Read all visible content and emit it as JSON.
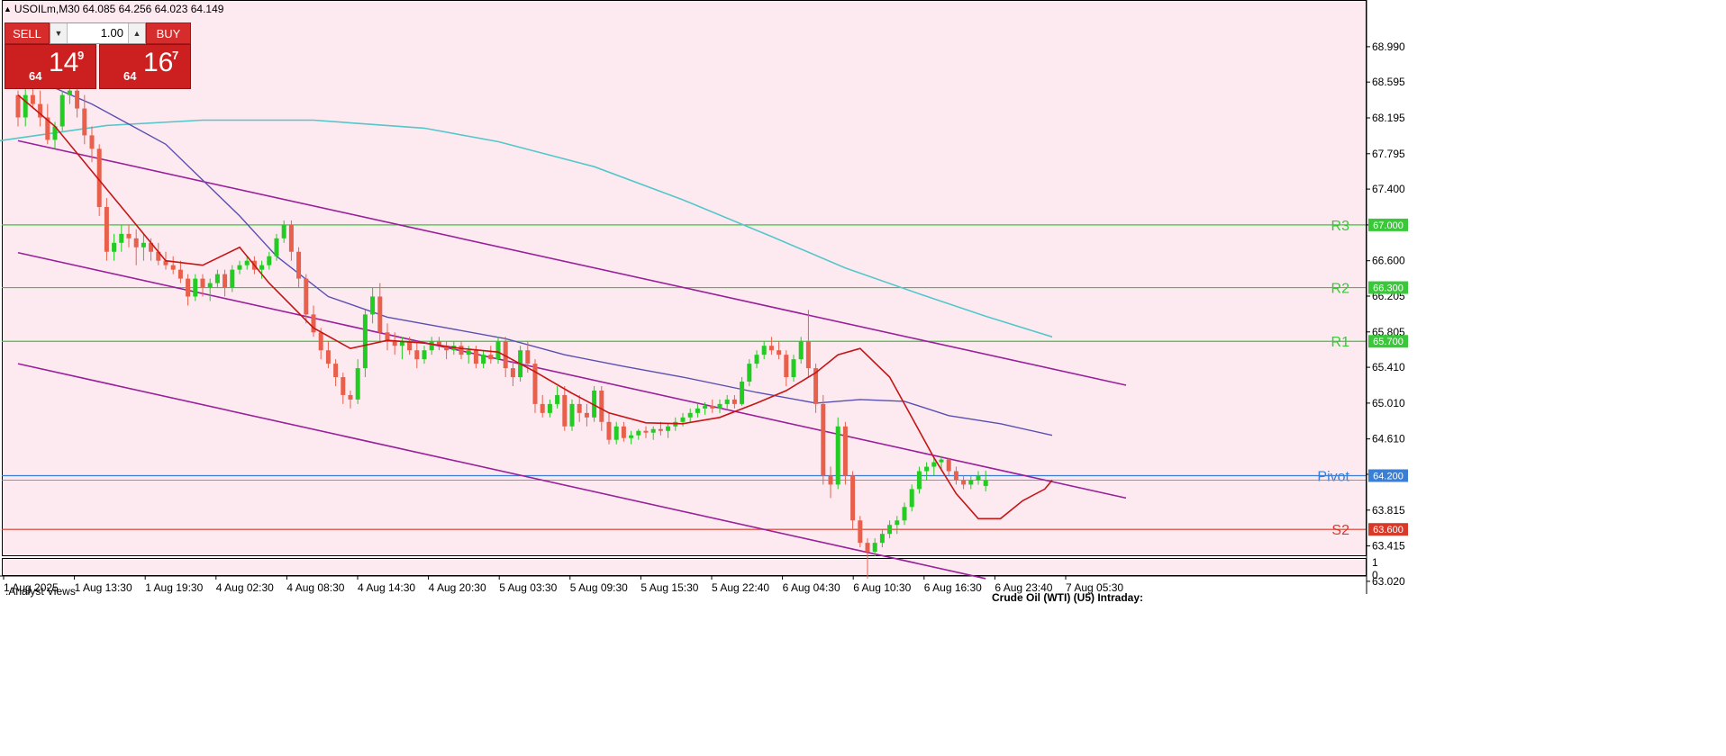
{
  "header": {
    "symbol_timeframe": "USOILm,M30",
    "ohlc": "64.085 64.256 64.023 64.149"
  },
  "trade_panel": {
    "sell_label": "SELL",
    "buy_label": "BUY",
    "lot_value": "1.00",
    "sell_price_small": "64",
    "sell_price_big": "14",
    "sell_price_sup": "9",
    "buy_price_small": "64",
    "buy_price_big": "16",
    "buy_price_sup": "7"
  },
  "indicator_window": {
    "label": ".Analyst Views",
    "scale_top": "1",
    "scale_bottom": "0"
  },
  "footer_title": "Crude Oil (WTI) (U5) Intraday:",
  "colors": {
    "background": "#fdeaf1",
    "bull_candle": "#22cc22",
    "bear_candle": "#e8604c",
    "ma_fast": "#c51515",
    "ma_mid": "#5a4fb0",
    "ma_slow": "#55c6c9",
    "channel": "#9a1f9a",
    "resistance": "#38c838",
    "pivot": "#3a7fd4",
    "support": "#d83a2a"
  },
  "chart_data": {
    "type": "candlestick",
    "price_axis_ticks": [
      "68.990",
      "68.595",
      "68.195",
      "67.795",
      "67.400",
      "67.000",
      "66.600",
      "66.205",
      "65.805",
      "65.410",
      "65.010",
      "64.610",
      "64.215",
      "63.815",
      "63.415",
      "63.020"
    ],
    "time_axis_ticks": [
      "1 Aug 2025",
      "1 Aug 13:30",
      "1 Aug 19:30",
      "4 Aug 02:30",
      "4 Aug 08:30",
      "4 Aug 14:30",
      "4 Aug 20:30",
      "5 Aug 03:30",
      "5 Aug 09:30",
      "5 Aug 15:30",
      "5 Aug 22:40",
      "6 Aug 04:30",
      "6 Aug 10:30",
      "6 Aug 16:30",
      "6 Aug 23:40",
      "7 Aug 05:30"
    ],
    "current_price": 64.149,
    "levels": [
      {
        "label": "R3",
        "value": 67.0,
        "tag": "67.000",
        "role": "resistance"
      },
      {
        "label": "R2",
        "value": 66.3,
        "tag": "66.300",
        "role": "resistance"
      },
      {
        "label": "R1",
        "value": 65.7,
        "tag": "65.700",
        "role": "resistance"
      },
      {
        "label": "Pivot",
        "value": 64.2,
        "tag": "64.200",
        "role": "pivot"
      },
      {
        "label": "S2",
        "value": 63.6,
        "tag": "63.600",
        "role": "support"
      }
    ],
    "channel": {
      "upper": [
        [
          0,
          67.94
        ],
        [
          150,
          65.21
        ]
      ],
      "middle": [
        [
          0,
          66.69
        ],
        [
          150,
          63.95
        ]
      ],
      "lower": [
        [
          0,
          65.45
        ],
        [
          131,
          63.05
        ]
      ]
    },
    "ma_slow": [
      [
        -10,
        67.85
      ],
      [
        0,
        67.97
      ],
      [
        12,
        68.11
      ],
      [
        25,
        68.17
      ],
      [
        40,
        68.17
      ],
      [
        55,
        68.08
      ],
      [
        65,
        67.93
      ],
      [
        78,
        67.65
      ],
      [
        90,
        67.28
      ],
      [
        102,
        66.87
      ],
      [
        112,
        66.52
      ],
      [
        122,
        66.23
      ],
      [
        131,
        65.98
      ],
      [
        140,
        65.75
      ]
    ],
    "ma_mid": [
      [
        3,
        68.6
      ],
      [
        10,
        68.35
      ],
      [
        20,
        67.9
      ],
      [
        30,
        67.1
      ],
      [
        35,
        66.65
      ],
      [
        42,
        66.2
      ],
      [
        50,
        65.97
      ],
      [
        58,
        65.85
      ],
      [
        66,
        65.73
      ],
      [
        74,
        65.55
      ],
      [
        82,
        65.42
      ],
      [
        90,
        65.3
      ],
      [
        100,
        65.13
      ],
      [
        108,
        65.01
      ],
      [
        114,
        65.05
      ],
      [
        120,
        65.03
      ],
      [
        126,
        64.87
      ],
      [
        133,
        64.78
      ],
      [
        140,
        64.65
      ]
    ],
    "ma_fast": [
      [
        0,
        68.45
      ],
      [
        5,
        68.1
      ],
      [
        10,
        67.6
      ],
      [
        15,
        67.1
      ],
      [
        20,
        66.6
      ],
      [
        25,
        66.55
      ],
      [
        30,
        66.75
      ],
      [
        34,
        66.35
      ],
      [
        40,
        65.85
      ],
      [
        45,
        65.62
      ],
      [
        50,
        65.71
      ],
      [
        55,
        65.68
      ],
      [
        60,
        65.62
      ],
      [
        65,
        65.58
      ],
      [
        70,
        65.36
      ],
      [
        75,
        65.12
      ],
      [
        80,
        64.9
      ],
      [
        85,
        64.79
      ],
      [
        90,
        64.78
      ],
      [
        95,
        64.85
      ],
      [
        100,
        65.01
      ],
      [
        104,
        65.15
      ],
      [
        108,
        65.35
      ],
      [
        111,
        65.55
      ],
      [
        114,
        65.62
      ],
      [
        118,
        65.3
      ],
      [
        121,
        64.85
      ],
      [
        124,
        64.4
      ],
      [
        127,
        64.0
      ],
      [
        130,
        63.72
      ],
      [
        133,
        63.72
      ],
      [
        136,
        63.92
      ],
      [
        139,
        64.05
      ],
      [
        140,
        64.15
      ]
    ],
    "candles": [
      [
        68.45,
        68.5,
        68.1,
        68.2
      ],
      [
        68.2,
        68.55,
        68.1,
        68.45
      ],
      [
        68.45,
        68.6,
        68.3,
        68.35
      ],
      [
        68.35,
        68.5,
        68.1,
        68.2
      ],
      [
        68.2,
        68.35,
        67.9,
        67.95
      ],
      [
        67.95,
        68.15,
        67.85,
        68.1
      ],
      [
        68.1,
        68.5,
        68.05,
        68.45
      ],
      [
        68.45,
        68.6,
        68.35,
        68.5
      ],
      [
        68.5,
        68.55,
        68.2,
        68.3
      ],
      [
        68.3,
        68.45,
        67.9,
        68.0
      ],
      [
        68.0,
        68.1,
        67.7,
        67.85
      ],
      [
        67.85,
        67.9,
        67.1,
        67.2
      ],
      [
        67.2,
        67.3,
        66.6,
        66.7
      ],
      [
        66.7,
        66.9,
        66.6,
        66.8
      ],
      [
        66.8,
        67.0,
        66.7,
        66.9
      ],
      [
        66.9,
        67.0,
        66.75,
        66.85
      ],
      [
        66.85,
        66.95,
        66.55,
        66.75
      ],
      [
        66.75,
        66.9,
        66.6,
        66.8
      ],
      [
        66.8,
        66.85,
        66.6,
        66.7
      ],
      [
        66.7,
        66.8,
        66.55,
        66.6
      ],
      [
        66.6,
        66.7,
        66.5,
        66.55
      ],
      [
        66.55,
        66.65,
        66.45,
        66.5
      ],
      [
        66.5,
        66.6,
        66.35,
        66.4
      ],
      [
        66.4,
        66.45,
        66.1,
        66.2
      ],
      [
        66.2,
        66.45,
        66.15,
        66.4
      ],
      [
        66.4,
        66.45,
        66.2,
        66.3
      ],
      [
        66.3,
        66.4,
        66.15,
        66.35
      ],
      [
        66.35,
        66.5,
        66.3,
        66.45
      ],
      [
        66.45,
        66.5,
        66.2,
        66.3
      ],
      [
        66.3,
        66.55,
        66.25,
        66.5
      ],
      [
        66.5,
        66.6,
        66.45,
        66.55
      ],
      [
        66.55,
        66.65,
        66.5,
        66.6
      ],
      [
        66.6,
        66.65,
        66.45,
        66.5
      ],
      [
        66.5,
        66.6,
        66.4,
        66.55
      ],
      [
        66.55,
        66.7,
        66.5,
        66.65
      ],
      [
        66.65,
        66.9,
        66.6,
        66.85
      ],
      [
        66.85,
        67.05,
        66.8,
        67.0
      ],
      [
        67.0,
        67.05,
        66.6,
        66.7
      ],
      [
        66.7,
        66.75,
        66.3,
        66.4
      ],
      [
        66.4,
        66.45,
        65.9,
        66.0
      ],
      [
        66.0,
        66.1,
        65.75,
        65.8
      ],
      [
        65.8,
        65.85,
        65.5,
        65.6
      ],
      [
        65.6,
        65.7,
        65.4,
        65.45
      ],
      [
        65.45,
        65.5,
        65.2,
        65.3
      ],
      [
        65.3,
        65.35,
        65.0,
        65.1
      ],
      [
        65.1,
        65.15,
        64.95,
        65.05
      ],
      [
        65.05,
        65.5,
        65.0,
        65.4
      ],
      [
        65.4,
        66.05,
        65.3,
        66.0
      ],
      [
        66.0,
        66.3,
        65.9,
        66.2
      ],
      [
        66.2,
        66.35,
        65.7,
        65.8
      ],
      [
        65.8,
        65.9,
        65.6,
        65.7
      ],
      [
        65.7,
        65.8,
        65.55,
        65.65
      ],
      [
        65.65,
        65.75,
        65.5,
        65.7
      ],
      [
        65.7,
        65.75,
        65.55,
        65.6
      ],
      [
        65.6,
        65.7,
        65.4,
        65.5
      ],
      [
        65.5,
        65.65,
        65.45,
        65.6
      ],
      [
        65.6,
        65.75,
        65.55,
        65.7
      ],
      [
        65.7,
        65.75,
        65.6,
        65.65
      ],
      [
        65.65,
        65.7,
        65.5,
        65.6
      ],
      [
        65.6,
        65.7,
        65.55,
        65.65
      ],
      [
        65.65,
        65.7,
        65.5,
        65.55
      ],
      [
        65.55,
        65.65,
        65.45,
        65.6
      ],
      [
        65.6,
        65.65,
        65.4,
        65.45
      ],
      [
        65.45,
        65.6,
        65.4,
        65.55
      ],
      [
        65.55,
        65.65,
        65.45,
        65.5
      ],
      [
        65.5,
        65.75,
        65.45,
        65.7
      ],
      [
        65.7,
        65.75,
        65.3,
        65.4
      ],
      [
        65.4,
        65.5,
        65.2,
        65.3
      ],
      [
        65.3,
        65.65,
        65.25,
        65.6
      ],
      [
        65.6,
        65.7,
        65.35,
        65.45
      ],
      [
        65.45,
        65.5,
        64.9,
        65.0
      ],
      [
        65.0,
        65.1,
        64.85,
        64.9
      ],
      [
        64.9,
        65.05,
        64.85,
        65.0
      ],
      [
        65.0,
        65.2,
        64.95,
        65.1
      ],
      [
        65.1,
        65.2,
        64.7,
        64.75
      ],
      [
        64.75,
        65.05,
        64.7,
        65.0
      ],
      [
        65.0,
        65.1,
        64.8,
        64.9
      ],
      [
        64.9,
        65.0,
        64.75,
        64.85
      ],
      [
        64.85,
        65.2,
        64.8,
        65.15
      ],
      [
        65.15,
        65.2,
        64.7,
        64.8
      ],
      [
        64.8,
        64.9,
        64.55,
        64.6
      ],
      [
        64.6,
        64.8,
        64.55,
        64.75
      ],
      [
        64.75,
        64.8,
        64.58,
        64.62
      ],
      [
        64.62,
        64.7,
        64.55,
        64.65
      ],
      [
        64.65,
        64.72,
        64.6,
        64.7
      ],
      [
        64.7,
        64.75,
        64.62,
        64.68
      ],
      [
        64.68,
        64.75,
        64.6,
        64.72
      ],
      [
        64.72,
        64.8,
        64.65,
        64.7
      ],
      [
        64.7,
        64.78,
        64.62,
        64.75
      ],
      [
        64.75,
        64.85,
        64.7,
        64.8
      ],
      [
        64.8,
        64.9,
        64.75,
        64.85
      ],
      [
        64.85,
        64.95,
        64.8,
        64.9
      ],
      [
        64.9,
        65.0,
        64.85,
        64.95
      ],
      [
        64.95,
        65.02,
        64.88,
        64.98
      ],
      [
        64.98,
        65.05,
        64.9,
        64.95
      ],
      [
        64.95,
        65.05,
        64.9,
        65.0
      ],
      [
        65.0,
        65.1,
        64.95,
        65.05
      ],
      [
        65.05,
        65.1,
        64.95,
        65.0
      ],
      [
        65.0,
        65.3,
        64.98,
        65.25
      ],
      [
        65.25,
        65.5,
        65.2,
        65.45
      ],
      [
        65.45,
        65.6,
        65.4,
        65.55
      ],
      [
        65.55,
        65.7,
        65.5,
        65.65
      ],
      [
        65.65,
        65.75,
        65.55,
        65.6
      ],
      [
        65.6,
        65.7,
        65.5,
        65.55
      ],
      [
        65.55,
        65.6,
        65.2,
        65.3
      ],
      [
        65.3,
        65.55,
        65.25,
        65.5
      ],
      [
        65.5,
        65.75,
        65.45,
        65.7
      ],
      [
        65.7,
        66.05,
        65.3,
        65.4
      ],
      [
        65.4,
        65.45,
        64.9,
        65.0
      ],
      [
        65.0,
        65.1,
        64.1,
        64.2
      ],
      [
        64.2,
        64.3,
        63.95,
        64.1
      ],
      [
        64.1,
        64.85,
        64.05,
        64.75
      ],
      [
        64.75,
        64.8,
        64.1,
        64.2
      ],
      [
        64.2,
        64.25,
        63.6,
        63.7
      ],
      [
        63.7,
        63.75,
        63.4,
        63.45
      ],
      [
        63.45,
        63.5,
        63.05,
        63.35
      ],
      [
        63.35,
        63.5,
        63.3,
        63.45
      ],
      [
        63.45,
        63.6,
        63.4,
        63.55
      ],
      [
        63.55,
        63.7,
        63.5,
        63.65
      ],
      [
        63.65,
        63.75,
        63.55,
        63.7
      ],
      [
        63.7,
        63.9,
        63.65,
        63.85
      ],
      [
        63.85,
        64.1,
        63.8,
        64.05
      ],
      [
        64.05,
        64.3,
        64.0,
        64.25
      ],
      [
        64.25,
        64.35,
        64.15,
        64.3
      ],
      [
        64.3,
        64.4,
        64.2,
        64.35
      ],
      [
        64.35,
        64.42,
        64.25,
        64.38
      ],
      [
        64.38,
        64.4,
        64.2,
        64.25
      ],
      [
        64.25,
        64.3,
        64.1,
        64.15
      ],
      [
        64.15,
        64.2,
        64.05,
        64.1
      ],
      [
        64.1,
        64.2,
        64.05,
        64.15
      ],
      [
        64.15,
        64.25,
        64.1,
        64.2
      ],
      [
        64.085,
        64.256,
        64.023,
        64.149
      ]
    ]
  }
}
